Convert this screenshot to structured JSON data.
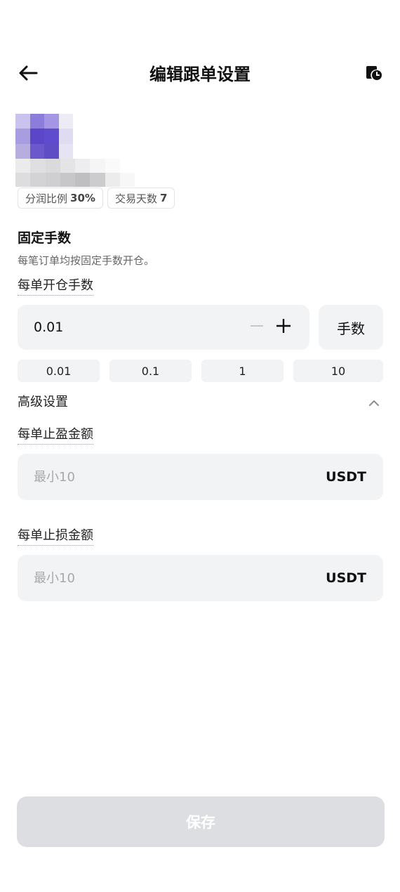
{
  "header": {
    "title": "编辑跟单设置",
    "back_icon": "arrow-left-icon",
    "history_icon": "history-icon"
  },
  "trader": {
    "tags": [
      {
        "label": "分润比例",
        "value": "30%"
      },
      {
        "label": "交易天数",
        "value": "7"
      }
    ]
  },
  "fixed_lots": {
    "title": "固定手数",
    "description": "每笔订单均按固定手数开仓。",
    "field_label": "每单开仓手数",
    "value": "0.01",
    "unit": "手数",
    "presets": [
      "0.01",
      "0.1",
      "1",
      "10"
    ]
  },
  "advanced": {
    "title": "高级设置",
    "expanded": true,
    "take_profit": {
      "label": "每单止盈金额",
      "placeholder": "最小10",
      "unit": "USDT"
    },
    "stop_loss": {
      "label": "每单止损金额",
      "placeholder": "最小10",
      "unit": "USDT"
    }
  },
  "footer": {
    "save_label": "保存",
    "save_enabled": false
  },
  "colors": {
    "input_bg": "#f1f3f4",
    "disabled_button_bg": "#dcdee1",
    "avatar_accent": "#5b46c8"
  }
}
